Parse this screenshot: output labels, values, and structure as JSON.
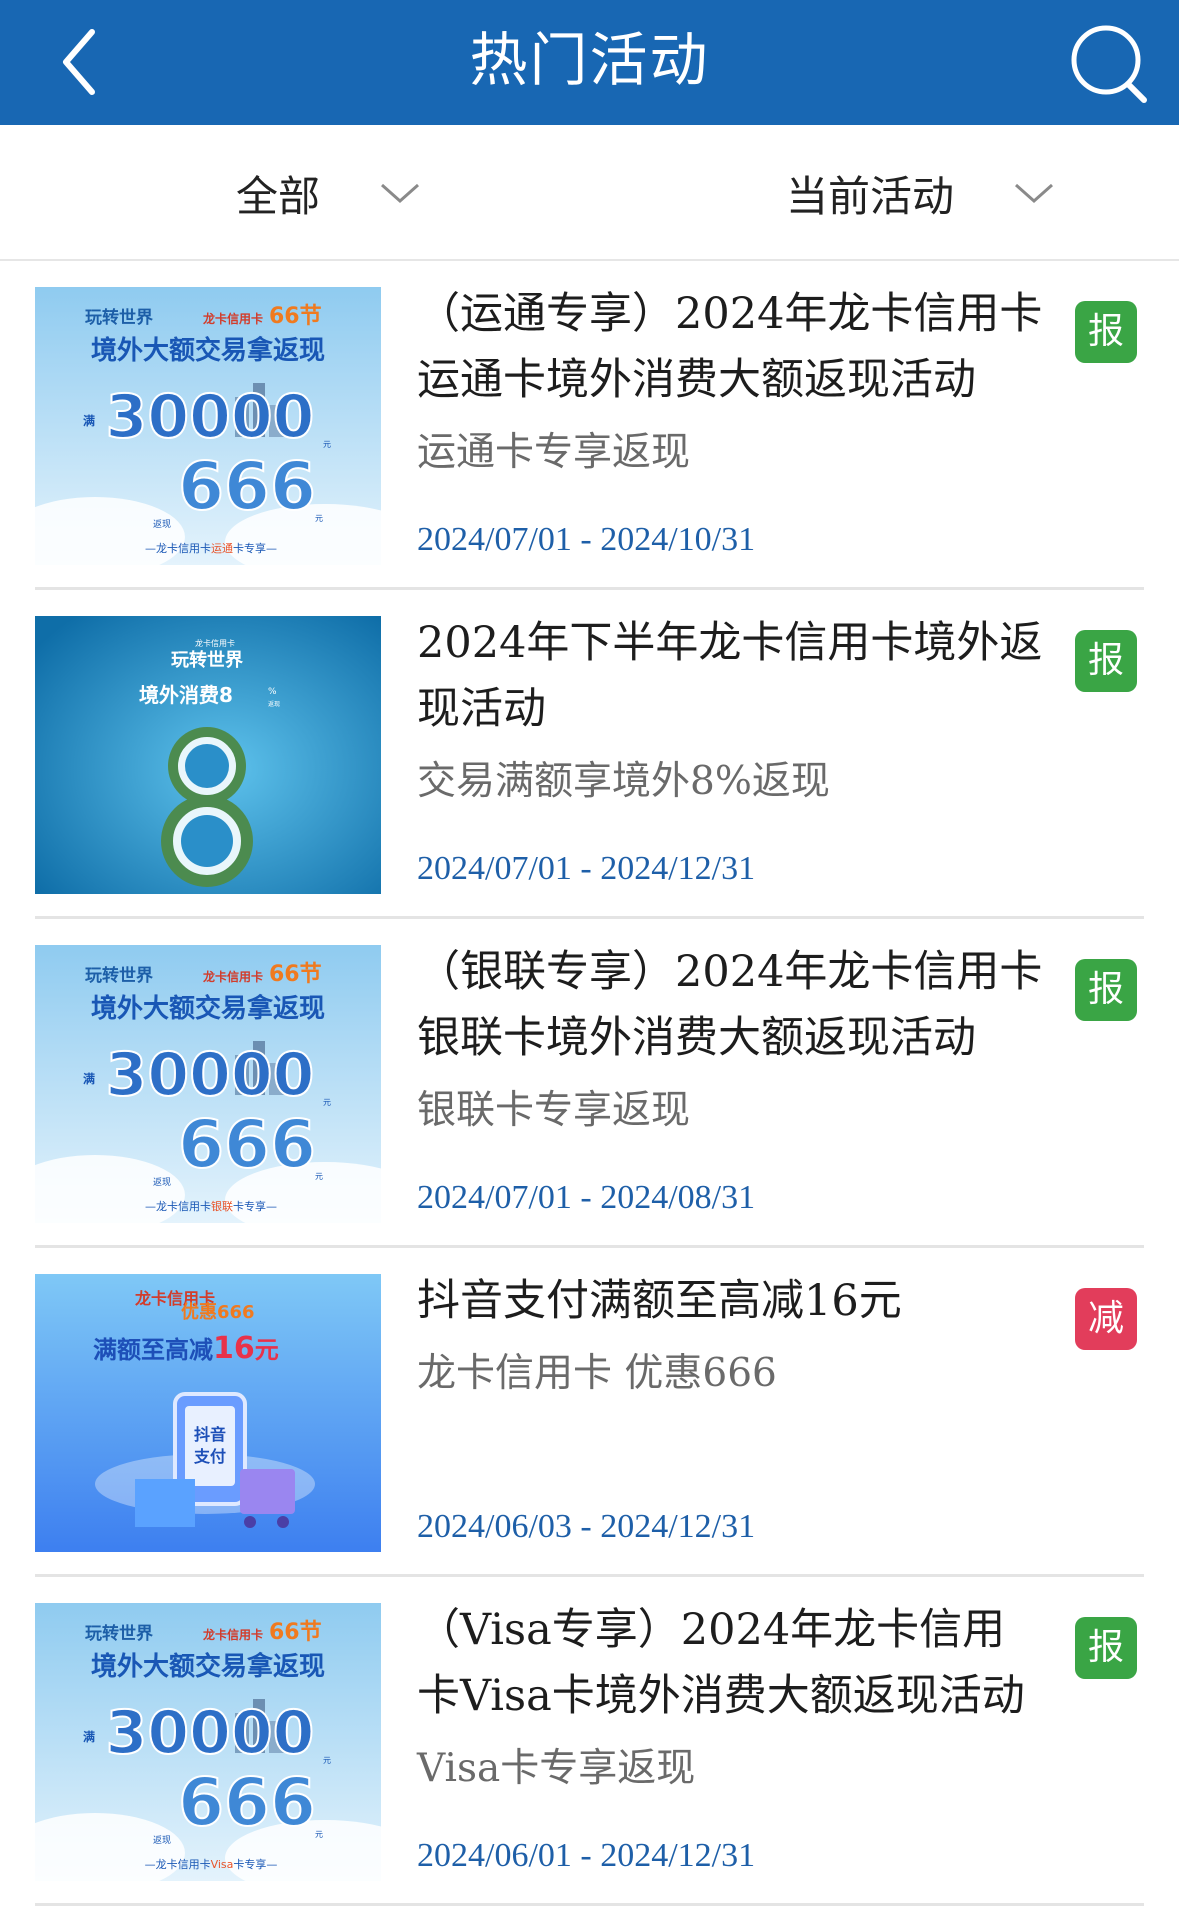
{
  "header": {
    "title": "热门活动",
    "back_icon": "chevron-left-icon",
    "search_icon": "search-icon",
    "background": "#1867b3"
  },
  "filters": {
    "category": "全部",
    "status": "当前活动"
  },
  "activities": [
    {
      "title": "（运通专享）2024年龙卡信用卡运通卡境外消费大额返现活动",
      "subtitle": "运通卡专享返现",
      "date_range": "2024/07/01 - 2024/10/31",
      "badge": "报",
      "badge_color": "#3aa545",
      "thumb": {
        "brand": "龙卡信用卡",
        "fest": "66节",
        "logo": "玩转世界",
        "headline": "境外大额交易拿返现",
        "amount": "30000",
        "amount_prefix": "满",
        "amount_unit": "元",
        "cashback": "666",
        "cashback_prefix": "返现",
        "cashback_unit": "元",
        "footer_left": "—龙卡信用卡",
        "footer_card": "运通",
        "footer_right": "卡专享—"
      }
    },
    {
      "title": "2024年下半年龙卡信用卡境外返现活动",
      "subtitle": "交易满额享境外8%返现",
      "date_range": "2024/07/01 - 2024/12/31",
      "badge": "报",
      "badge_color": "#3aa545",
      "thumb": {
        "small_brand": "龙卡信用卡",
        "logo": "玩转世界",
        "headline": "境外消费8",
        "pct": "%",
        "pct_note": "返现",
        "big_digit": "8"
      }
    },
    {
      "title": "（银联专享）2024年龙卡信用卡银联卡境外消费大额返现活动",
      "subtitle": "银联卡专享返现",
      "date_range": "2024/07/01 - 2024/08/31",
      "badge": "报",
      "badge_color": "#3aa545",
      "thumb": {
        "brand": "龙卡信用卡",
        "fest": "66节",
        "logo": "玩转世界",
        "headline": "境外大额交易拿返现",
        "amount": "30000",
        "amount_prefix": "满",
        "amount_unit": "元",
        "cashback": "666",
        "cashback_prefix": "返现",
        "cashback_unit": "元",
        "footer_left": "—龙卡信用卡",
        "footer_card": "银联",
        "footer_right": "卡专享—"
      }
    },
    {
      "title": "抖音支付满额至高减16元",
      "subtitle": "龙卡信用卡 优惠666",
      "date_range": "2024/06/03 - 2024/12/31",
      "badge": "减",
      "badge_color": "#e23d5b",
      "thumb": {
        "brand": "龙卡信用卡",
        "promo": "优惠666",
        "headline_pre": "满额至高减",
        "headline_num": "16",
        "headline_unit": "元",
        "phone_text_1": "抖音",
        "phone_text_2": "支付"
      }
    },
    {
      "title": "（Visa专享）2024年龙卡信用卡Visa卡境外消费大额返现活动",
      "subtitle": "Visa卡专享返现",
      "date_range": "2024/06/01 - 2024/12/31",
      "badge": "报",
      "badge_color": "#3aa545",
      "thumb": {
        "brand": "龙卡信用卡",
        "fest": "66节",
        "logo": "玩转世界",
        "headline": "境外大额交易拿返现",
        "amount": "30000",
        "amount_prefix": "满",
        "amount_unit": "元",
        "cashback": "666",
        "cashback_prefix": "返现",
        "cashback_unit": "元",
        "footer_left": "—龙卡信用卡",
        "footer_card": "Visa",
        "footer_right": "卡专享—"
      }
    }
  ]
}
